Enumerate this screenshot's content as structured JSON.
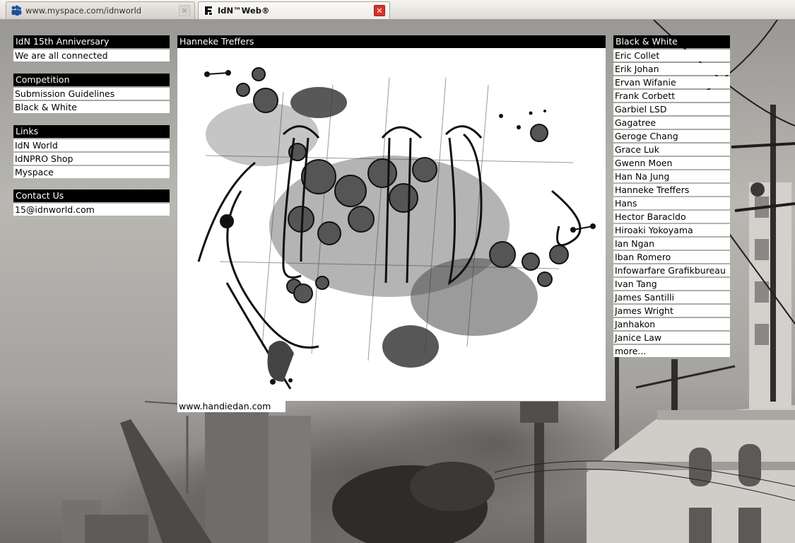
{
  "tabs": [
    {
      "title": "www.myspace.com/idnworld",
      "icon": "myspace-people-icon",
      "active": false
    },
    {
      "title": "IdN™Web®",
      "icon": "idn-logo-icon",
      "active": true
    }
  ],
  "left": {
    "anniversary": {
      "header": "IdN 15th Anniversary",
      "items": [
        "We are all connected"
      ]
    },
    "competition": {
      "header": "Competition",
      "items": [
        "Submission Guidelines",
        "Black & White"
      ]
    },
    "links": {
      "header": "Links",
      "items": [
        "IdN World",
        "IdNPRO Shop",
        "Myspace"
      ]
    },
    "contact": {
      "header": "Contact Us",
      "items": [
        "15@idnworld.com"
      ]
    }
  },
  "main": {
    "title": "Hanneke  Treffers",
    "artwork": "ink-illustration-artwork",
    "url": "www.handiedan.com"
  },
  "right": {
    "header": "Black & White",
    "items": [
      "Eric Collet",
      "Erik Johan",
      "Ervan Wifanie",
      "Frank Corbett",
      "Garbiel LSD",
      "Gagatree",
      "Geroge Chang",
      "Grace Luk",
      "Gwenn Moen",
      "Han Na Jung",
      "Hanneke Treffers",
      "Hans",
      "Hector Baracldo",
      "Hiroaki Yokoyama",
      "Ian Ngan",
      "Iban Romero",
      "Infowarfare Grafikbureau",
      "Ivan Tang",
      "James Santilli",
      "James Wright",
      "Janhakon",
      "Janice Law"
    ],
    "more": "more..."
  },
  "colors": {
    "header_bg": "#000000",
    "header_text": "#ffffff",
    "row_bg": "#ffffff",
    "close_active": "#d8322b"
  }
}
